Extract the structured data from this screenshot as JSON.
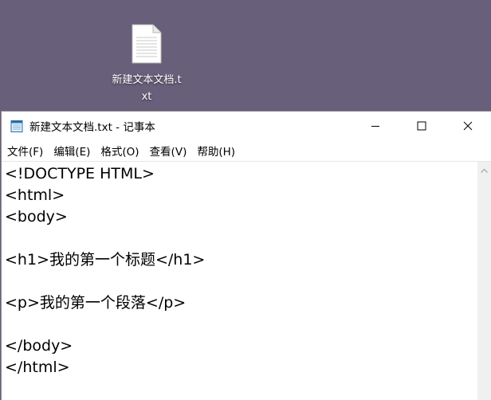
{
  "desktop": {
    "icon_label": "新建文本文档.txt"
  },
  "window": {
    "title": "新建文本文档.txt - 记事本",
    "menus": [
      "文件(F)",
      "编辑(E)",
      "格式(O)",
      "查看(V)",
      "帮助(H)"
    ],
    "content": "<!DOCTYPE HTML>\n<html>\n<body>\n\n<h1>我的第一个标题</h1>\n\n<p>我的第一个段落</p>\n\n</body>\n</html>"
  },
  "colors": {
    "desktop_bg": "#685f7a",
    "window_bg": "#ffffff"
  },
  "icons": [
    "text-document-icon",
    "notepad-icon",
    "minimize-icon",
    "maximize-icon",
    "close-icon",
    "scroll-up-arrow-icon"
  ]
}
